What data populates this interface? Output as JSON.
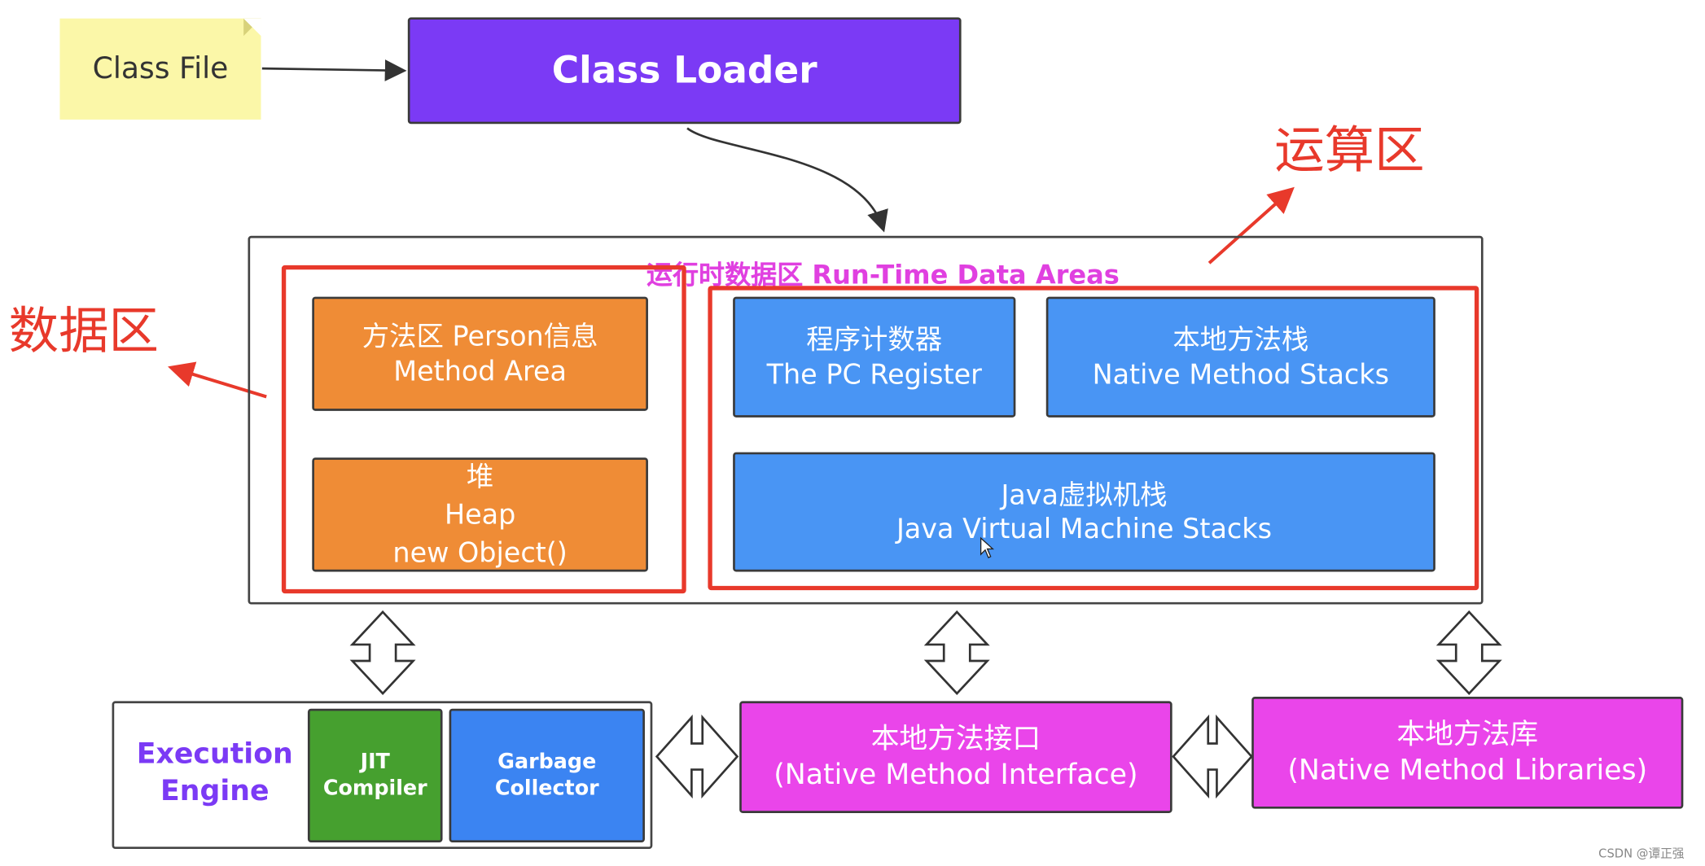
{
  "class_file": {
    "label": "Class File"
  },
  "class_loader": {
    "label": "Class Loader",
    "color": "#7b3af5"
  },
  "runtime": {
    "title": "运行时数据区 Run-Time Data Areas",
    "title_color": "#e040e0"
  },
  "annotations": {
    "data_zone": "数据区",
    "compute_zone": "运算区",
    "color": "#e8392b"
  },
  "method_area": {
    "line1": "方法区  Person信息",
    "line2": "Method Area"
  },
  "heap": {
    "line1": "堆",
    "line2": "Heap",
    "line3": "new Object()"
  },
  "pc_register": {
    "line1": "程序计数器",
    "line2": "The PC Register"
  },
  "native_stacks": {
    "line1": "本地方法栈",
    "line2": "Native Method Stacks"
  },
  "jvm_stacks": {
    "line1": "Java虚拟机栈",
    "line2": "Java Virtual Machine Stacks"
  },
  "execution_engine": {
    "label_line1": "Execution",
    "label_line2": "Engine",
    "jit_line1": "JIT",
    "jit_line2": "Compiler",
    "gc_line1": "Garbage",
    "gc_line2": "Collector"
  },
  "native_interface": {
    "line1": "本地方法接口",
    "line2": "(Native Method Interface)"
  },
  "native_libraries": {
    "line1": "本地方法库",
    "line2": "(Native Method Libraries)"
  },
  "watermark": "CSDN @谭正强"
}
